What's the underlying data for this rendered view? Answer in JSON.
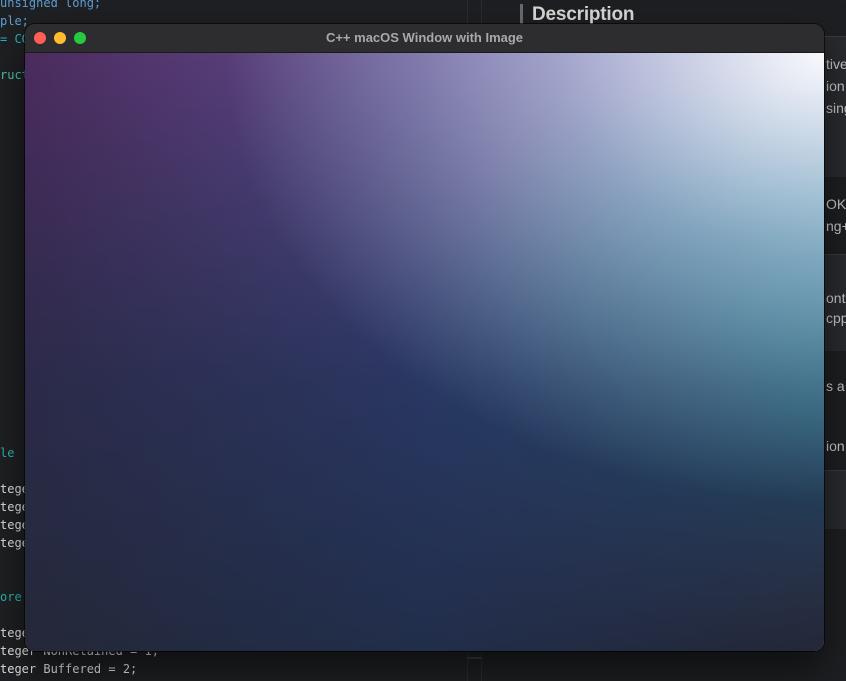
{
  "window": {
    "title": "C++ macOS Window with Image",
    "image_description_icon": "gradient-image"
  },
  "editor": {
    "lines": [
      {
        "text": "unsigned long;",
        "top": 0
      },
      {
        "text": "ple;",
        "top": 0
      },
      {
        "text": "= CG",
        "top": 0
      },
      {
        "text": "ruct",
        "top": 0
      },
      {
        "text": "le",
        "top": 0
      },
      {
        "text": "tege",
        "top": 0
      },
      {
        "text": "tege",
        "top": 0
      },
      {
        "text": "tege",
        "top": 0
      },
      {
        "text": "tege",
        "top": 0
      },
      {
        "text": "ore",
        "top": 0
      },
      {
        "text": "tege",
        "top": 0
      },
      {
        "text": "teger NonRetained = 1;",
        "top": 0
      },
      {
        "text": "teger Buffered = 2;",
        "top": 0
      }
    ]
  },
  "doc": {
    "title": "Description",
    "fragments": [
      "tive",
      "ion",
      "sing",
      "OK a",
      "ng+",
      "ont",
      "cpp",
      "s a",
      "ion"
    ]
  },
  "colors": {
    "close": "#ff5f57",
    "minimize": "#febc2e",
    "zoom": "#28c840"
  }
}
